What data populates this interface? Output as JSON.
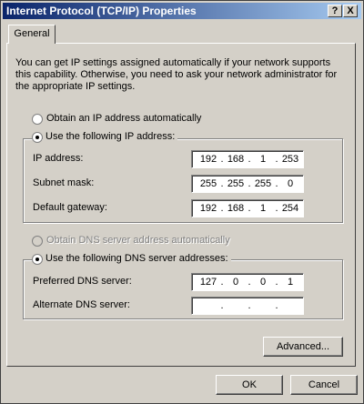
{
  "window": {
    "title": "Internet Protocol (TCP/IP) Properties",
    "help_label": "?",
    "close_label": "X"
  },
  "tabs": [
    {
      "label": "General"
    }
  ],
  "description": "You can get IP settings assigned automatically if your network supports this capability. Otherwise, you need to ask your network administrator for the appropriate IP settings.",
  "ip_section": {
    "auto_label": "Obtain an IP address automatically",
    "manual_label": "Use the following IP address:",
    "selected": "manual",
    "fields": [
      {
        "label": "IP address:",
        "octets": [
          "192",
          "168",
          "1",
          "253"
        ]
      },
      {
        "label": "Subnet mask:",
        "octets": [
          "255",
          "255",
          "255",
          "0"
        ]
      },
      {
        "label": "Default gateway:",
        "octets": [
          "192",
          "168",
          "1",
          "254"
        ]
      }
    ]
  },
  "dns_section": {
    "auto_label": "Obtain DNS server address automatically",
    "auto_enabled": false,
    "manual_label": "Use the following DNS server addresses:",
    "selected": "manual",
    "fields": [
      {
        "label": "Preferred DNS server:",
        "octets": [
          "127",
          "0",
          "0",
          "1"
        ]
      },
      {
        "label": "Alternate DNS server:",
        "octets": [
          "",
          "",
          "",
          ""
        ]
      }
    ]
  },
  "buttons": {
    "advanced": "Advanced...",
    "ok": "OK",
    "cancel": "Cancel"
  },
  "colors": {
    "dialog_bg": "#d4d0c8",
    "title_start": "#0a246a",
    "title_end": "#a6caf0"
  }
}
